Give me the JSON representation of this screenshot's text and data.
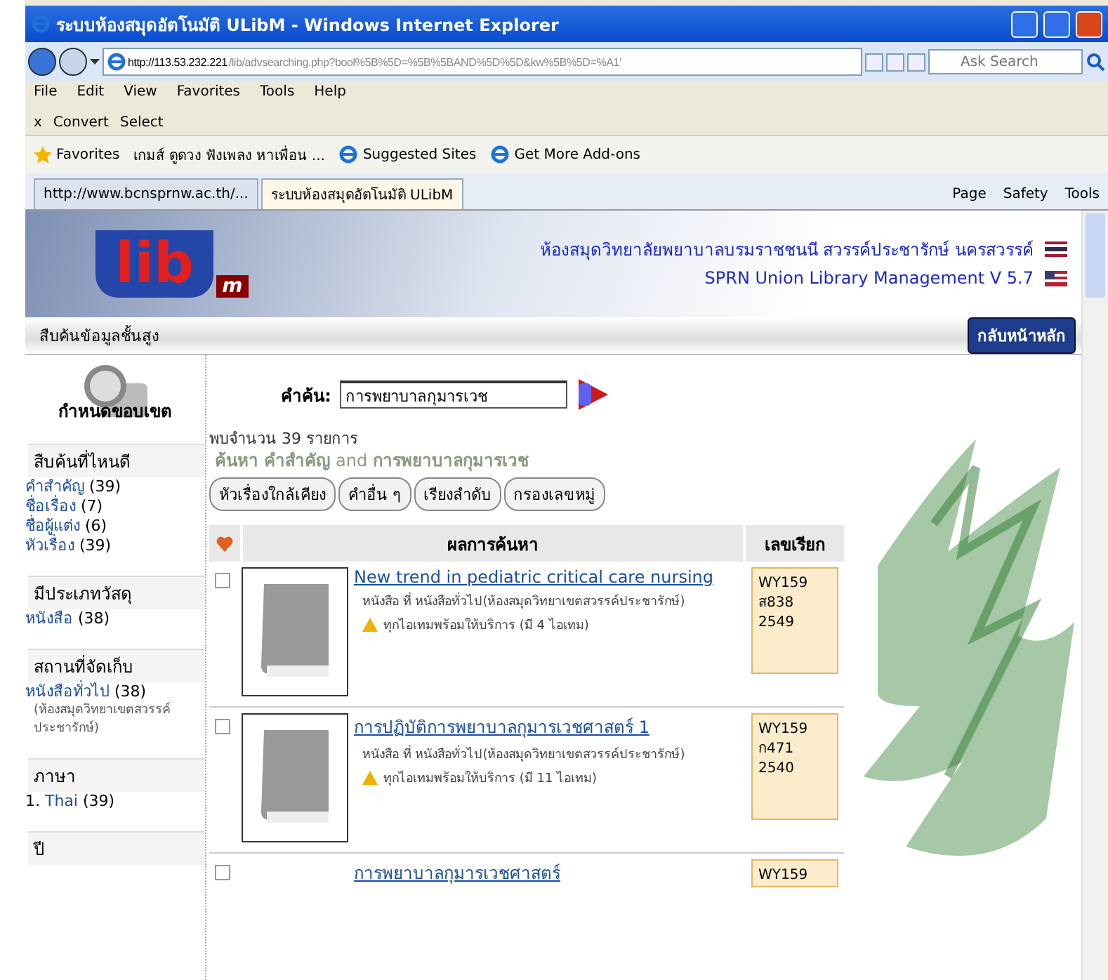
{
  "window": {
    "title": "ระบบห้องสมุดอัตโนมัติ ULibM - Windows Internet Explorer"
  },
  "address_bar": {
    "url_host": "http://113.53.232.221",
    "url_path": "/lib/advsearching.php?bool%5B%5D=%5B%5BAND%5D%5D&kw%5B%5D=%A1'"
  },
  "search_box": {
    "placeholder": "Ask Search"
  },
  "menu": [
    "File",
    "Edit",
    "View",
    "Favorites",
    "Tools",
    "Help"
  ],
  "toolbar": {
    "close": "x",
    "items": [
      "Convert",
      "Select"
    ]
  },
  "favorites_bar": {
    "label": "Favorites",
    "items": [
      "เกมส์ ดูดวง ฟังเพลง หาเพื่อน ...",
      "Suggested Sites",
      "Get More Add-ons"
    ]
  },
  "tabs": [
    {
      "label": "http://www.bcnsprnw.ac.th/...",
      "selected": false
    },
    {
      "label": "ระบบห้องสมุดอัตโนมัติ ULibM",
      "selected": true
    }
  ],
  "command_bar": [
    "Page",
    "Safety",
    "Tools"
  ],
  "page": {
    "logo": {
      "text": "lib",
      "sub": "m"
    },
    "header_lines": [
      "ห้องสมุดวิทยาลัยพยาบาลบรมราชชนนี สวรรค์ประชารักษ์ นครสวรรค์",
      "SPRN Union Library Management V 5.7"
    ],
    "breadcrumb": "สืบค้นข้อมูลชั้นสูง",
    "home_button": "กลับหน้าหลัก",
    "sidebar": {
      "scope_label": "กำหนดขอบเขต",
      "facets": [
        {
          "heading": "สืบค้นที่ไหนดี",
          "items": [
            {
              "label": "คำสำคัญ",
              "count": "(39)"
            },
            {
              "label": "ชื่อเรื่อง",
              "count": "(7)"
            },
            {
              "label": "ชื่อผู้แต่ง",
              "count": "(6)"
            },
            {
              "label": "หัวเรื่อง",
              "count": "(39)"
            }
          ]
        },
        {
          "heading": "มีประเภทวัสดุ",
          "items": [
            {
              "label": "หนังสือ",
              "count": "(38)"
            }
          ]
        },
        {
          "heading": "สถานที่จัดเก็บ",
          "items": [
            {
              "label": "หนังสือทั่วไป",
              "count": "(38)",
              "note": "(ห้องสมุดวิทยาเขตสวรรค์ประชารักษ์)"
            }
          ]
        },
        {
          "heading": "ภาษา",
          "items": [
            {
              "prefix": "1. ",
              "label": "Thai",
              "count": "(39)"
            }
          ]
        },
        {
          "heading": "ปี"
        }
      ]
    },
    "search": {
      "label": "คำค้น:",
      "value": "การพยาบาลกุมารเวช"
    },
    "result_count": "พบจำนวน 39 รายการ",
    "query_summary": "**ค้นหา คำสำคัญ** and **การพยาบาลกุมารเวช**",
    "buttons": [
      "หัวเรื่องใกล้เคียง",
      "คำอื่น ๆ",
      "เรียงลำดับ",
      "กรองเลขหมู่"
    ],
    "table": {
      "columns": [
        "ผลการค้นหา",
        "เลขเรียก"
      ],
      "rows": [
        {
          "checked": false,
          "title": "New trend in pediatric critical care nursing",
          "detail": "หนังสือ ที่ หนังสือทั่วไป(ห้องสมุดวิทยาเขตสวรรค์ประชารักษ์)",
          "status": "ทุกไอเทมพร้อมให้บริการ (มี 4 ไอเทม)",
          "call_number": [
            "WY159",
            "ส838 2549"
          ]
        },
        {
          "checked": false,
          "title": "การปฏิบัติการพยาบาลกุมารเวชศาสตร์ 1",
          "detail": "หนังสือ ที่ หนังสือทั่วไป(ห้องสมุดวิทยาเขตสวรรค์ประชารักษ์)",
          "status": "ทุกไอเทมพร้อมให้บริการ (มี 11 ไอเทม)",
          "call_number": [
            "WY159",
            "ก471 2540"
          ]
        },
        {
          "checked": false,
          "title": "การพยาบาลกุมารเวชศาสตร์",
          "call_number": [
            "WY159"
          ]
        }
      ]
    }
  }
}
